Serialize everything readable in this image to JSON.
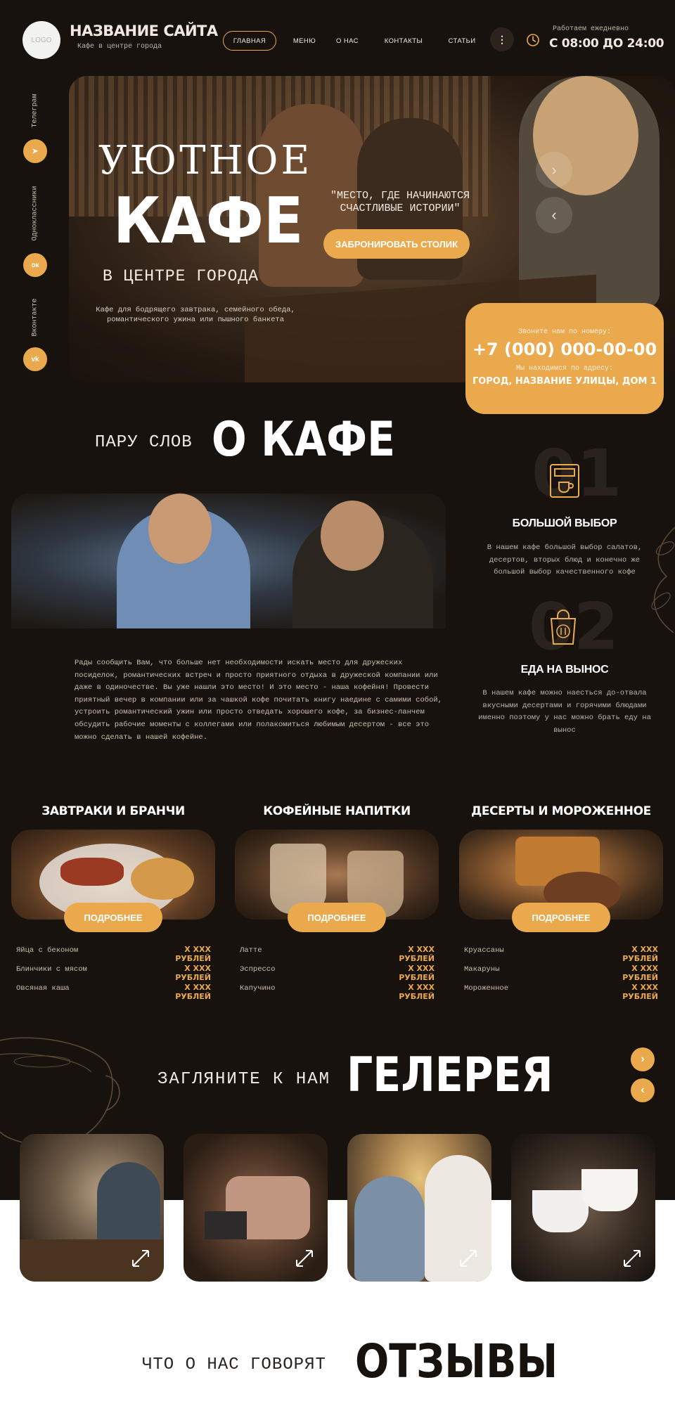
{
  "header": {
    "logo": "LOGO",
    "title": "НАЗВАНИЕ САЙТА",
    "subtitle": "Кафе в центре города",
    "nav": [
      "ГЛАВНАЯ",
      "МЕНЮ",
      "О НАС",
      "КОНТАКТЫ",
      "СТАТЬИ"
    ],
    "more_icon": "⋮",
    "work_label": "Работаем ежедневно",
    "work_hours": "С 08:00 ДО 24:00"
  },
  "socials": [
    {
      "label": "Телеграм",
      "icon": "telegram-icon",
      "glyph": "➤"
    },
    {
      "label": "Одноклассники",
      "icon": "odnoklassniki-icon",
      "glyph": "ок"
    },
    {
      "label": "Вконтакте",
      "icon": "vk-icon",
      "glyph": "vk"
    }
  ],
  "hero": {
    "line1": "УЮТНОЕ",
    "line2": "КАФЕ",
    "line3": "В ЦЕНТРЕ ГОРОДА",
    "description": "Кафе для бодрящего завтрака, семейного обеда, романтического ужина или пышного банкета",
    "quote": "\"МЕСТО, ГДЕ НАЧИНАЮТСЯ СЧАСТЛИВЫЕ ИСТОРИИ\"",
    "book_button": "ЗАБРОНИРОВАТЬ СТОЛИК",
    "next_arrow": "›",
    "prev_arrow": "‹"
  },
  "contact": {
    "call_label": "Звоните нам по номеру:",
    "phone": "+7 (000) 000-00-00",
    "address_label": "Мы находимся по адресу:",
    "address": "ГОРОД, НАЗВАНИЕ УЛИЦЫ, ДОМ 1"
  },
  "about": {
    "pre": "ПАРУ СЛОВ",
    "title": "О КАФЕ",
    "text": "Рады сообщить Вам, что больше нет необходимости искать место для дружеских посиделок, романтических встреч и просто приятного отдыха в дружеской компании или даже в одиночестве. Вы уже нашли это место! И это место - наша кофейня! Провести приятный вечер в компании или за чашкой кофе почитать книгу наедине с самими собой, устроить романтический ужин или просто отведать хорошего кофе, за бизнес-ланчем обсудить рабочие моменты с коллегами или полакомиться любимым десертом - все это можно сделать в нашей кофейне.",
    "features": [
      {
        "num": "01",
        "icon": "coffee-machine-icon",
        "title": "БОЛЬШОЙ ВЫБОР",
        "text": "В нашем кафе большой выбор салатов, десертов, вторых блюд и конечно же большой выбор качественного кофе"
      },
      {
        "num": "02",
        "icon": "takeaway-bag-icon",
        "title": "ЕДА НА ВЫНОС",
        "text": "В нашем кафе можно наесться до-отвала вкусными десертами и горячими блюдами именно поэтому у нас можно брать еду на вынос"
      }
    ]
  },
  "menu": [
    {
      "title": "ЗАВТРАКИ И БРАНЧИ",
      "button": "ПОДРОБНЕЕ",
      "items": [
        {
          "name": "Яйца с беконом",
          "price": "X XXX РУБЛЕЙ"
        },
        {
          "name": "Блинчики с мясом",
          "price": "X XXX РУБЛЕЙ"
        },
        {
          "name": "Овсяная каша",
          "price": "X XXX РУБЛЕЙ"
        }
      ]
    },
    {
      "title": "КОФЕЙНЫЕ НАПИТКИ",
      "button": "ПОДРОБНЕЕ",
      "items": [
        {
          "name": "Латте",
          "price": "X XXX РУБЛЕЙ"
        },
        {
          "name": "Эспрессо",
          "price": "X XXX РУБЛЕЙ"
        },
        {
          "name": "Капучино",
          "price": "X XXX РУБЛЕЙ"
        }
      ]
    },
    {
      "title": "ДЕСЕРТЫ И МОРОЖЕННОЕ",
      "button": "ПОДРОБНЕЕ",
      "items": [
        {
          "name": "Круассаны",
          "price": "X XXX РУБЛЕЙ"
        },
        {
          "name": "Макаруны",
          "price": "X XXX РУБЛЕЙ"
        },
        {
          "name": "Мороженное",
          "price": "X XXX РУБЛЕЙ"
        }
      ]
    }
  ],
  "gallery": {
    "pre": "ЗАГЛЯНИТЕ К НАМ",
    "title": "ГЕЛЕРЕЯ",
    "next_arrow": "›",
    "prev_arrow": "‹"
  },
  "reviews": {
    "pre": "ЧТО О НАС ГОВОРЯТ",
    "title": "ОТЗЫВЫ"
  },
  "colors": {
    "accent": "#eaa94c",
    "background": "#17120e",
    "white": "#ffffff"
  }
}
